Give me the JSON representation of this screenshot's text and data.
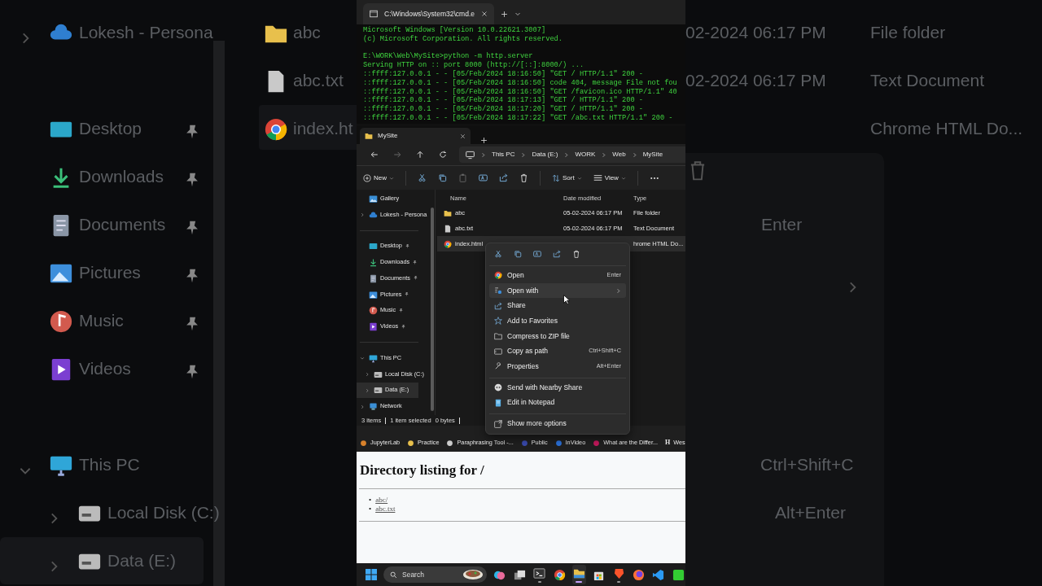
{
  "backdrop_left": {
    "nav_groups": [
      [
        {
          "label": "Lokesh - Persona",
          "selected": false,
          "pinned": false,
          "expanded": false
        }
      ],
      [
        {
          "label": "Desktop",
          "selected": false,
          "pinned": true
        },
        {
          "label": "Downloads",
          "selected": false,
          "pinned": true
        },
        {
          "label": "Documents",
          "selected": false,
          "pinned": true
        },
        {
          "label": "Pictures",
          "selected": false,
          "pinned": true
        },
        {
          "label": "Music",
          "selected": false,
          "pinned": true
        },
        {
          "label": "Videos",
          "selected": false,
          "pinned": true
        }
      ],
      [
        {
          "label": "This PC",
          "selected": false,
          "pinned": false,
          "expanded": true
        },
        {
          "label": "Local Disk (C:)",
          "selected": false,
          "pinned": false,
          "expanded": false
        },
        {
          "label": "Data (E:)",
          "selected": true,
          "pinned": false,
          "expanded": false
        }
      ]
    ],
    "files": [
      {
        "name": "abc",
        "selected": false
      },
      {
        "name": "abc.txt",
        "selected": false
      },
      {
        "name": "index.ht",
        "selected": true
      }
    ]
  },
  "backdrop_right": {
    "files": [
      {
        "date": "02-2024 06:17 PM",
        "type": "File folder"
      },
      {
        "date": "02-2024 06:17 PM",
        "type": "Text Document"
      },
      {
        "type": "Chrome HTML Do..."
      }
    ],
    "shortcuts": [
      "Enter",
      "Ctrl+Shift+C",
      "Alt+Enter"
    ]
  },
  "terminal": {
    "tab_title": "C:\\Windows\\System32\\cmd.e",
    "blocks": [
      [
        "Microsoft Windows [Version 10.0.22621.3007]",
        "(c) Microsoft Corporation. All rights reserved."
      ],
      [
        "E:\\WORK\\Web\\MySite>python -m http.server",
        "Serving HTTP on :: port 8000 (http://[::]:8000/) ...",
        "::ffff:127.0.0.1 - - [05/Feb/2024 18:16:50] \"GET / HTTP/1.1\" 200 -",
        "::ffff:127.0.0.1 - - [05/Feb/2024 18:16:50] code 404, message File not fou",
        "::ffff:127.0.0.1 - - [05/Feb/2024 18:16:50] \"GET /favicon.ico HTTP/1.1\" 40",
        "::ffff:127.0.0.1 - - [05/Feb/2024 18:17:13] \"GET / HTTP/1.1\" 200 -",
        "::ffff:127.0.0.1 - - [05/Feb/2024 18:17:20] \"GET / HTTP/1.1\" 200 -",
        "::ffff:127.0.0.1 - - [05/Feb/2024 18:17:22] \"GET /abc.txt HTTP/1.1\" 200 -"
      ]
    ]
  },
  "explorer": {
    "tab_title": "MySite",
    "breadcrumb": [
      "This PC",
      "Data (E:)",
      "WORK",
      "Web",
      "MySite"
    ],
    "toolbar": {
      "new": "New",
      "sort": "Sort",
      "view": "View",
      "paste_disabled": true
    },
    "nav_groups": [
      [
        {
          "label": "Gallery",
          "selected": false,
          "pinned": false
        },
        {
          "label": "Lokesh - Persona",
          "selected": false,
          "pinned": false,
          "expanded": false
        }
      ],
      [
        {
          "label": "Desktop",
          "selected": false,
          "pinned": true
        },
        {
          "label": "Downloads",
          "selected": false,
          "pinned": true
        },
        {
          "label": "Documents",
          "selected": false,
          "pinned": true
        },
        {
          "label": "Pictures",
          "selected": false,
          "pinned": true
        },
        {
          "label": "Music",
          "selected": false,
          "pinned": true
        },
        {
          "label": "Videos",
          "selected": false,
          "pinned": true
        }
      ],
      [
        {
          "label": "This PC",
          "selected": false,
          "pinned": false,
          "expanded": true
        },
        {
          "label": "Local Disk (C:)",
          "selected": false,
          "pinned": false,
          "expanded": false
        },
        {
          "label": "Data (E:)",
          "selected": true,
          "pinned": false,
          "expanded": false
        },
        {
          "label": "Network",
          "selected": false,
          "pinned": false,
          "expanded": false
        }
      ]
    ],
    "columns": [
      "Name",
      "Date modified",
      "Type"
    ],
    "files": [
      {
        "name": "abc",
        "date": "05-02-2024 06:17 PM",
        "type": "File folder",
        "selected": false
      },
      {
        "name": "abc.txt",
        "date": "05-02-2024 06:17 PM",
        "type": "Text Document",
        "selected": false
      },
      {
        "name": "index.html",
        "type": "hrome HTML Do...",
        "selected": true
      }
    ],
    "status": [
      "3 items",
      "1 item selected",
      "0 bytes"
    ]
  },
  "context_menu": {
    "groups": [
      [
        {
          "label": "Open",
          "shortcut": "Enter",
          "submenu": false,
          "selected": false
        },
        {
          "label": "Open with",
          "submenu": true,
          "selected": true
        },
        {
          "label": "Share",
          "submenu": false,
          "selected": false
        },
        {
          "label": "Add to Favorites",
          "submenu": false,
          "selected": false
        },
        {
          "label": "Compress to ZIP file",
          "submenu": false,
          "selected": false
        },
        {
          "label": "Copy as path",
          "shortcut": "Ctrl+Shift+C",
          "submenu": false,
          "selected": false
        },
        {
          "label": "Properties",
          "shortcut": "Alt+Enter",
          "submenu": false,
          "selected": false
        }
      ],
      [
        {
          "label": "Send with Nearby Share",
          "submenu": false,
          "selected": false
        },
        {
          "label": "Edit in Notepad",
          "submenu": false,
          "selected": false
        }
      ],
      [
        {
          "label": "Show more options",
          "submenu": false,
          "selected": false
        }
      ]
    ]
  },
  "bookmarks": [
    {
      "label": "JupyterLab"
    },
    {
      "label": "Practice"
    },
    {
      "label": "Paraphrasing Tool -..."
    },
    {
      "label": "Public"
    },
    {
      "label": "InVideo"
    },
    {
      "label": "What are the Differ..."
    },
    {
      "badge": "H",
      "label": "Wes"
    }
  ],
  "page": {
    "heading": "Directory listing for /",
    "links": [
      {
        "bullet": "•",
        "label": "abc/"
      },
      {
        "bullet": "•",
        "label": "abc.txt"
      }
    ]
  },
  "taskbar": {
    "search_placeholder": "Search",
    "apps": [
      {
        "running": false,
        "active": false
      },
      {
        "running": false,
        "active": false
      },
      {
        "running": true,
        "active": false
      },
      {
        "running": false,
        "active": false
      },
      {
        "running": true,
        "active": true
      },
      {
        "running": false,
        "active": false
      },
      {
        "running": true,
        "active": false
      },
      {
        "running": false,
        "active": false
      },
      {
        "running": false,
        "active": false
      },
      {
        "running": false,
        "active": false
      }
    ]
  }
}
